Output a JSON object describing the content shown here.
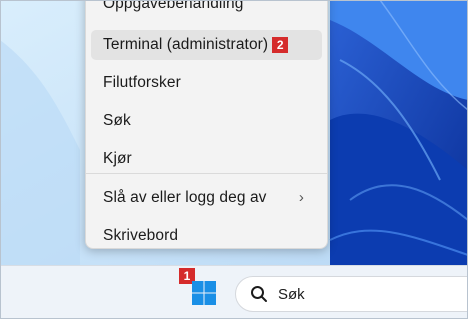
{
  "menu": {
    "items": [
      {
        "label": "Oppgavebehandling"
      },
      {
        "label": "Terminal (administrator)",
        "badge": "2"
      },
      {
        "label": "Filutforsker"
      },
      {
        "label": "Søk"
      },
      {
        "label": "Kjør"
      },
      {
        "label": "Slå av eller logg deg av"
      },
      {
        "label": "Skrivebord"
      }
    ]
  },
  "taskbar": {
    "start_badge": "1",
    "search_label": "Søk"
  },
  "colors": {
    "badge": "#d52b2b",
    "start_blue": "#1a8fe6",
    "menu_bg": "#f3f3f3",
    "taskbar_bg": "#eef3f9"
  },
  "icons": [
    "windows-logo-icon",
    "search-icon",
    "chevron-right-icon"
  ]
}
